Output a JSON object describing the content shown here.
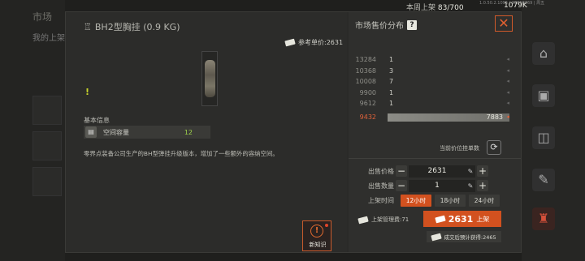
{
  "background": {
    "title": "市场",
    "sub_label": "我的上架",
    "listings_label": "本周上架",
    "listings_value": "83/700",
    "money": "1079K",
    "version": "1.0.50.2.1096 | 93860369 | 周五"
  },
  "item": {
    "name": "BH2型胸挂 (0.9 KG)",
    "ref_price_label": "参考单价:2631",
    "section_label": "基本信息",
    "stat_name": "空间容量",
    "stat_value": "12",
    "description": "零界点装备公司生产的BH型弹挂升级版本，增加了一些额外的容纳空间。",
    "knowledge_label": "新知识",
    "knowledge_glyph": "!",
    "excl": "!"
  },
  "market": {
    "title": "市场售价分布",
    "help": "?",
    "close": "✕",
    "distribution": [
      {
        "price": "13284",
        "count": "1"
      },
      {
        "price": "10368",
        "count": "3"
      },
      {
        "price": "10008",
        "count": "7"
      },
      {
        "price": "9900",
        "count": "1"
      },
      {
        "price": "9612",
        "count": "1"
      },
      {
        "price": "9432",
        "count": "7883",
        "mine": true
      }
    ],
    "current_count_label": "当前价位挂单数",
    "refresh": "⟳",
    "price_label": "出售价格",
    "price_value": "2631",
    "qty_label": "出售数量",
    "qty_value": "1",
    "duration_label": "上架时间",
    "durations": [
      "12小时",
      "18小时",
      "24小时"
    ],
    "minus": "−",
    "plus": "+",
    "pencil": "✎",
    "fee_label": "上架管理费:71",
    "list_price": "2631",
    "list_label": "上架",
    "estimate_label": "成交后预计获得:2465"
  },
  "colors": {
    "accent": "#d2511f",
    "positive": "#9ccf4a",
    "price_highlight": "#e0623a"
  }
}
